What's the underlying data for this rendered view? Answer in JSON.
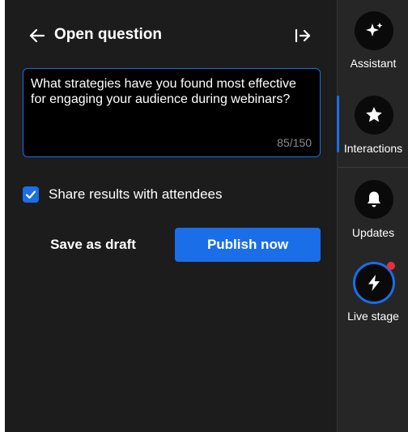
{
  "panel": {
    "title": "Open question",
    "question": {
      "text": "What strategies have you found most effective for engaging your audience during webinars?",
      "char_count": "85/150"
    },
    "share_results": {
      "label": "Share results with attendees",
      "checked": true
    },
    "actions": {
      "draft_label": "Save as draft",
      "publish_label": "Publish now"
    }
  },
  "rail": {
    "items": [
      {
        "label": "Assistant",
        "icon": "sparkle-icon"
      },
      {
        "label": "Interactions",
        "icon": "star-icon",
        "active": true
      },
      {
        "label": "Updates",
        "icon": "bell-icon"
      },
      {
        "label": "Live stage",
        "icon": "lightning-icon",
        "notification": true
      }
    ]
  },
  "colors": {
    "accent": "#1a6ee8",
    "panel_bg": "#1c1c1c",
    "rail_bg": "#262626",
    "notification": "#e8303a"
  }
}
